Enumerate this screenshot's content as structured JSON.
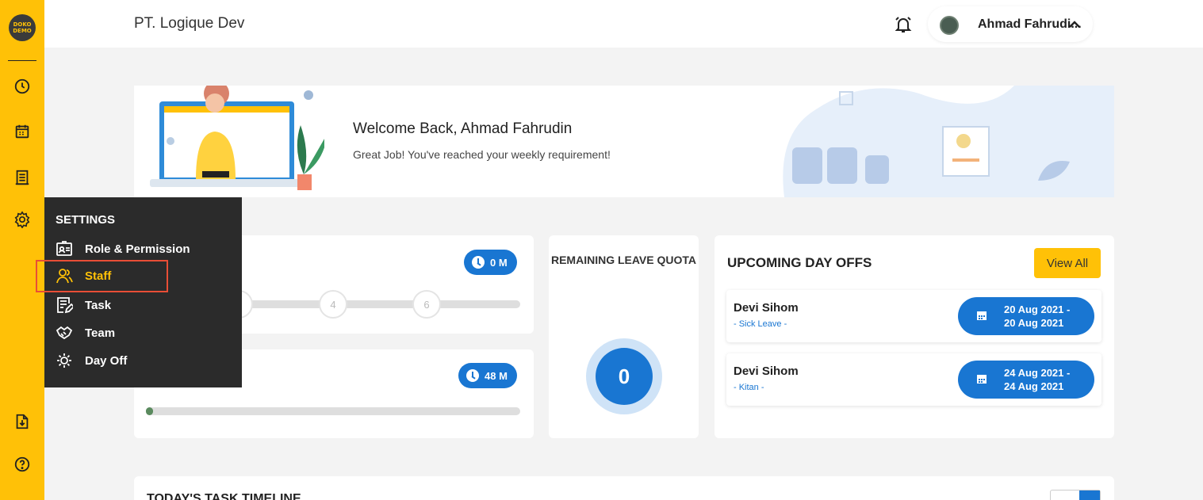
{
  "app": {
    "logo_text": "DOKO DEMO"
  },
  "header": {
    "company": "PT. Logique Dev",
    "user_name": "Ahmad Fahrudi..."
  },
  "sidebar": {
    "items": [
      {
        "icon": "clock-icon"
      },
      {
        "icon": "calendar-icon"
      },
      {
        "icon": "report-icon"
      },
      {
        "icon": "gear-icon"
      },
      {
        "icon": "download-icon"
      },
      {
        "icon": "help-icon"
      }
    ]
  },
  "settings_menu": {
    "title": "SETTINGS",
    "items": [
      {
        "label": "Role & Permission",
        "icon": "id-card-icon"
      },
      {
        "label": "Staff",
        "icon": "staff-icon",
        "active": true
      },
      {
        "label": "Task",
        "icon": "task-icon"
      },
      {
        "label": "Team",
        "icon": "handshake-icon"
      },
      {
        "label": "Day Off",
        "icon": "day-off-icon"
      }
    ]
  },
  "banner": {
    "welcome": "Welcome Back, Ahmad Fahrudin",
    "message": "Great Job! You've reached your weekly requirement!"
  },
  "stats": {
    "card1_badge": "0 M",
    "steps": [
      "4",
      "6"
    ],
    "card2_badge": "48 M",
    "card2_progress": 0.02
  },
  "leave_quota": {
    "title": "REMAINING LEAVE QUOTA",
    "value": "0"
  },
  "upcoming": {
    "title": "UPCOMING DAY OFFS",
    "view_all": "View All",
    "items": [
      {
        "name": "Devi Sihom",
        "type": "- Sick Leave -",
        "date_from": "20 Aug 2021 -",
        "date_to": "20 Aug 2021"
      },
      {
        "name": "Devi Sihom",
        "type": "- Kitan -",
        "date_from": "24 Aug 2021 -",
        "date_to": "24 Aug 2021"
      }
    ]
  },
  "timeline": {
    "title": "TODAY'S TASK TIMELINE"
  },
  "colors": {
    "accent": "#ffc107",
    "primary": "#1976d2",
    "sidebar_dark": "#2b2b2b",
    "highlight": "#e94e36"
  }
}
